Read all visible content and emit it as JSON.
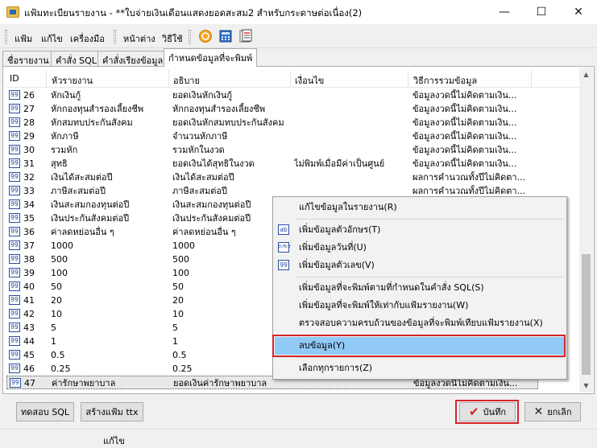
{
  "window": {
    "title": "แฟ้มทะเบียนรายงาน - **ใบจ่ายเงินเดือนแสดงยอดสะสม2 สำหรับกระดาษต่อเนื่อง(2)",
    "minimize": "—",
    "maximize": "☐",
    "close": "✕"
  },
  "toolbar": {
    "file": "แฟ้ม",
    "edit": "แก้ไข",
    "tools": "เครื่องมือ",
    "window": "หน้าต่าง",
    "help": "วิธีใช้"
  },
  "tabs": [
    {
      "label": "ชื่อรายงาน"
    },
    {
      "label": "คำสั่ง SQL"
    },
    {
      "label": "คำสั่งเรียงข้อมูล"
    },
    {
      "label": "กำหนดข้อมูลที่จะพิมพ์"
    }
  ],
  "grid": {
    "headers": [
      "ID",
      "หัวรายงาน",
      "อธิบาย",
      "เงื่อนไข",
      "วิธีการรวมข้อมูล"
    ],
    "icon_text": "99",
    "rows": [
      {
        "id": "26",
        "head": "หักเงินกู้",
        "desc": "ยอดเงินหักเงินกู้",
        "cond": "",
        "agg": "ข้อมูลงวดนี้ไม่คิดตามเงิน..."
      },
      {
        "id": "27",
        "head": "หักกองทุนสำรองเลี้ยงชีพ",
        "desc": "หักกองทุนสำรองเลี้ยงชีพ",
        "cond": "",
        "agg": "ข้อมูลงวดนี้ไม่คิดตามเงิน..."
      },
      {
        "id": "28",
        "head": "หักสมทบประกันสังคม",
        "desc": "ยอดเงินหักสมทบประกันสังคม",
        "cond": "",
        "agg": "ข้อมูลงวดนี้ไม่คิดตามเงิน..."
      },
      {
        "id": "29",
        "head": "หักภาษี",
        "desc": "จำนวนหักภาษี",
        "cond": "",
        "agg": "ข้อมูลงวดนี้ไม่คิดตามเงิน..."
      },
      {
        "id": "30",
        "head": "รวมหัก",
        "desc": "รวมหักในงวด",
        "cond": "",
        "agg": "ข้อมูลงวดนี้ไม่คิดตามเงิน..."
      },
      {
        "id": "31",
        "head": "สุทธิ",
        "desc": "ยอดเงินได้สุทธิในงวด",
        "cond": "ไม่พิมพ์เมื่อมีค่าเป็นศูนย์",
        "agg": "ข้อมูลงวดนี้ไม่คิดตามเงิน..."
      },
      {
        "id": "32",
        "head": "เงินได้สะสมต่อปี",
        "desc": "เงินได้สะสมต่อปี",
        "cond": "",
        "agg": "ผลการคำนวณทั้งปีไม่คิดตา..."
      },
      {
        "id": "33",
        "head": "ภาษีสะสมต่อปี",
        "desc": "ภาษีสะสมต่อปี",
        "cond": "",
        "agg": "ผลการคำนวณทั้งปีไม่คิดตา..."
      },
      {
        "id": "34",
        "head": "เงินสะสมกองทุนต่อปี",
        "desc": "เงินสะสมกองทุนต่อปี",
        "cond": "",
        "agg": ""
      },
      {
        "id": "35",
        "head": "เงินประกันสังคมต่อปี",
        "desc": "เงินประกันสังคมต่อปี",
        "cond": "",
        "agg": ""
      },
      {
        "id": "36",
        "head": "ค่าลดหย่อนอื่น ๆ",
        "desc": "ค่าลดหย่อนอื่น ๆ",
        "cond": "",
        "agg": ""
      },
      {
        "id": "37",
        "head": "1000",
        "desc": "1000",
        "cond": "",
        "agg": ""
      },
      {
        "id": "38",
        "head": "500",
        "desc": "500",
        "cond": "",
        "agg": ""
      },
      {
        "id": "39",
        "head": "100",
        "desc": "100",
        "cond": "",
        "agg": ""
      },
      {
        "id": "40",
        "head": "50",
        "desc": "50",
        "cond": "",
        "agg": ""
      },
      {
        "id": "41",
        "head": "20",
        "desc": "20",
        "cond": "",
        "agg": ""
      },
      {
        "id": "42",
        "head": "10",
        "desc": "10",
        "cond": "",
        "agg": ""
      },
      {
        "id": "43",
        "head": "5",
        "desc": "5",
        "cond": "",
        "agg": ""
      },
      {
        "id": "44",
        "head": "1",
        "desc": "1",
        "cond": "",
        "agg": ""
      },
      {
        "id": "45",
        "head": "0.5",
        "desc": "0.5",
        "cond": "",
        "agg": ""
      },
      {
        "id": "46",
        "head": "0.25",
        "desc": "0.25",
        "cond": "",
        "agg": ""
      },
      {
        "id": "47",
        "head": "ค่ารักษาพยาบาล",
        "desc": "ยอดเงินค่ารักษาพยาบาล",
        "cond": "",
        "agg": "ข้อมูลงวดนี้ไม่คิดตามเงิน..."
      }
    ]
  },
  "context_menu": {
    "items": [
      {
        "label": "แก้ไขข้อมูลในรายงาน(R)",
        "icon": ""
      },
      {
        "label": "เพิ่มข้อมูลตัวอักษร(T)",
        "icon": "ab"
      },
      {
        "label": "เพิ่มข้อมูลวันที่(U)",
        "icon": "D/M/Y"
      },
      {
        "label": "เพิ่มข้อมูลตัวเลข(V)",
        "icon": "99"
      },
      {
        "label": "เพิ่มข้อมูลที่จะพิมพ์ตามที่กำหนดในคำสั่ง SQL(S)",
        "icon": ""
      },
      {
        "label": "เพิ่มข้อมูลที่จะพิมพ์ให้เท่ากับแฟ้มรายงาน(W)",
        "icon": ""
      },
      {
        "label": "ตรวจสอบความครบถ้วนของข้อมูลที่จะพิมพ์เทียบแฟ้มรายงาน(X)",
        "icon": ""
      },
      {
        "label": "ลบข้อมูล(Y)",
        "icon": ""
      },
      {
        "label": "เลือกทุกรายการ(Z)",
        "icon": ""
      }
    ]
  },
  "buttons": {
    "test_sql": "ทดสอบ SQL",
    "create_ttx": "สร้างแฟ้ม ttx",
    "save": "บันทึก",
    "cancel": "ยกเลิก"
  },
  "status": {
    "text": "แก้ไข"
  },
  "colors": {
    "highlight_red": "#d8232a",
    "menu_hover": "#91c9f7",
    "save_check": "#d21f1f",
    "cancel_x": "#222222"
  }
}
